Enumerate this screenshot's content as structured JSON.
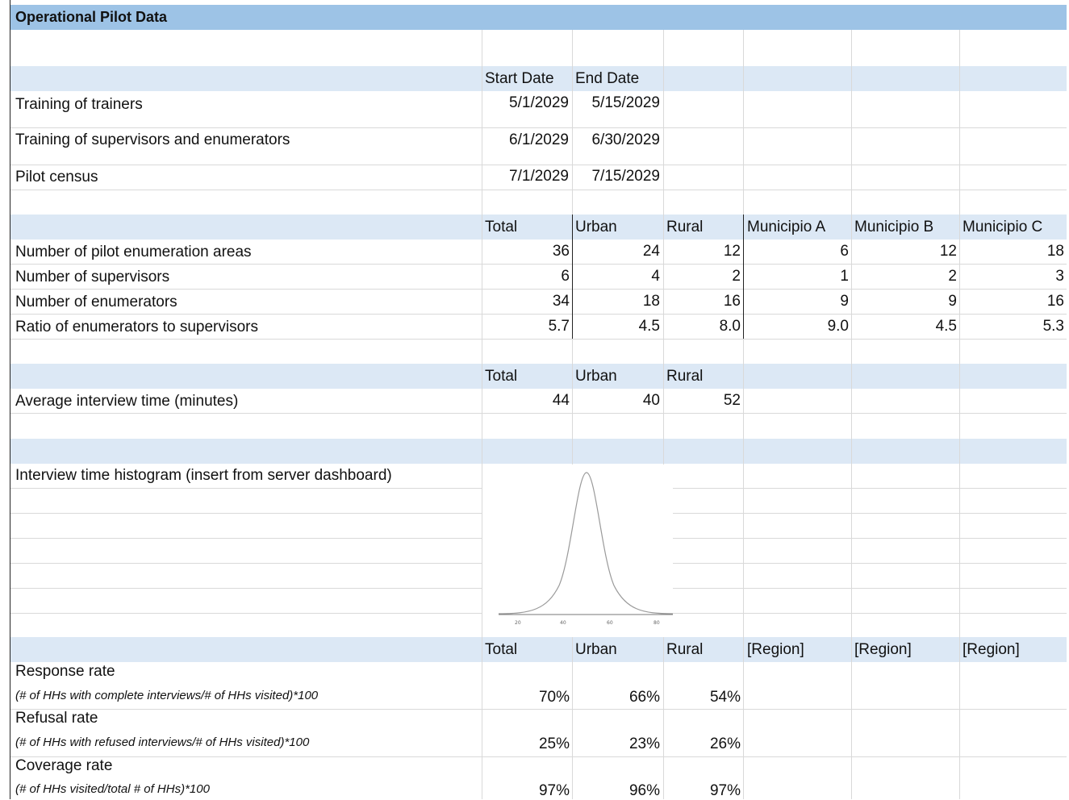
{
  "title": "Operational Pilot Data",
  "schedule": {
    "headers": [
      "Start Date",
      "End Date"
    ],
    "rows": [
      {
        "label": "Training of trainers",
        "start": "5/1/2029",
        "end": "5/15/2029"
      },
      {
        "label": "Training of supervisors and enumerators",
        "start": "6/1/2029",
        "end": "6/30/2029"
      },
      {
        "label": "Pilot census",
        "start": "7/1/2029",
        "end": "7/15/2029"
      }
    ]
  },
  "staffing": {
    "headers": [
      "Total",
      "Urban",
      "Rural",
      "Municipio A",
      "Municipio B",
      "Municipio C"
    ],
    "rows": [
      {
        "label": "Number of pilot enumeration areas",
        "values": [
          "36",
          "24",
          "12",
          "6",
          "12",
          "18"
        ]
      },
      {
        "label": "Number of supervisors",
        "values": [
          "6",
          "4",
          "2",
          "1",
          "2",
          "3"
        ]
      },
      {
        "label": "Number of enumerators",
        "values": [
          "34",
          "18",
          "16",
          "9",
          "9",
          "16"
        ]
      },
      {
        "label": "Ratio of enumerators to supervisors",
        "values": [
          "5.7",
          "4.5",
          "8.0",
          "9.0",
          "4.5",
          "5.3"
        ]
      }
    ]
  },
  "interview": {
    "headers": [
      "Total",
      "Urban",
      "Rural"
    ],
    "label": "Average interview time (minutes)",
    "values": [
      "44",
      "40",
      "52"
    ]
  },
  "histogram": {
    "label": "Interview time histogram (insert from server dashboard)",
    "tick_labels": [
      "20",
      "40",
      "60",
      "80"
    ]
  },
  "rates": {
    "headers": [
      "Total",
      "Urban",
      "Rural",
      "[Region]",
      "[Region]",
      "[Region]"
    ],
    "rows": [
      {
        "label": "Response rate",
        "formula": "(# of HHs with complete interviews/# of HHs visited)*100",
        "values": [
          "70%",
          "66%",
          "54%"
        ]
      },
      {
        "label": "Refusal rate",
        "formula": "(# of HHs with refused interviews/# of HHs visited)*100",
        "values": [
          "25%",
          "23%",
          "26%"
        ]
      },
      {
        "label": "Coverage rate",
        "formula": "(# of HHs visited/total # of HHs)*100",
        "values": [
          "97%",
          "96%",
          "97%"
        ]
      }
    ]
  }
}
